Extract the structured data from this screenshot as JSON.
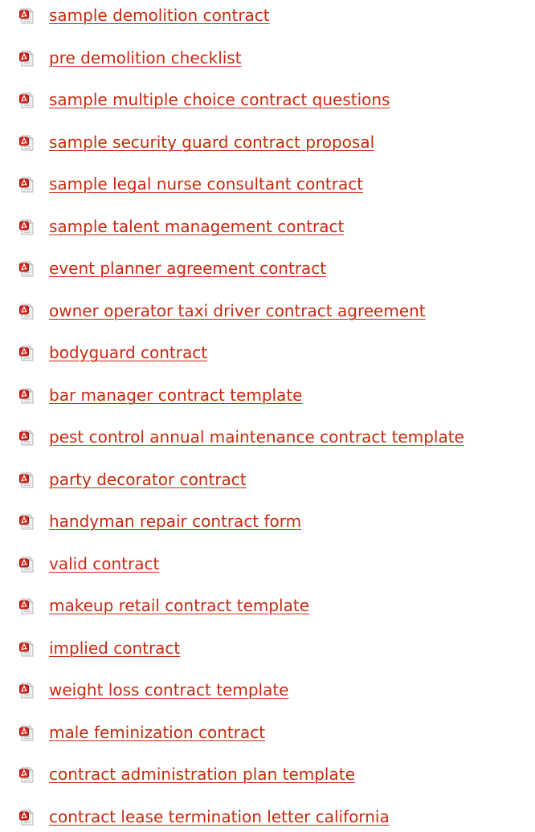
{
  "colors": {
    "link": "#c8290f",
    "icon_badge": "#d7261e",
    "icon_page": "#e6e6e6"
  },
  "icon_name": "pdf-file-icon",
  "links": [
    {
      "label": "sample demolition contract"
    },
    {
      "label": "pre demolition checklist"
    },
    {
      "label": "sample multiple choice contract questions"
    },
    {
      "label": "sample security guard contract proposal"
    },
    {
      "label": "sample legal nurse consultant contract"
    },
    {
      "label": "sample talent management contract"
    },
    {
      "label": "event planner agreement contract"
    },
    {
      "label": "owner operator taxi driver contract agreement"
    },
    {
      "label": "bodyguard contract"
    },
    {
      "label": "bar manager contract template"
    },
    {
      "label": "pest control annual maintenance contract template"
    },
    {
      "label": "party decorator contract"
    },
    {
      "label": "handyman repair contract form"
    },
    {
      "label": "valid contract"
    },
    {
      "label": "makeup retail contract template"
    },
    {
      "label": "implied contract"
    },
    {
      "label": "weight loss contract template"
    },
    {
      "label": "male feminization contract"
    },
    {
      "label": "contract administration plan template"
    },
    {
      "label": "contract lease termination letter california"
    }
  ]
}
